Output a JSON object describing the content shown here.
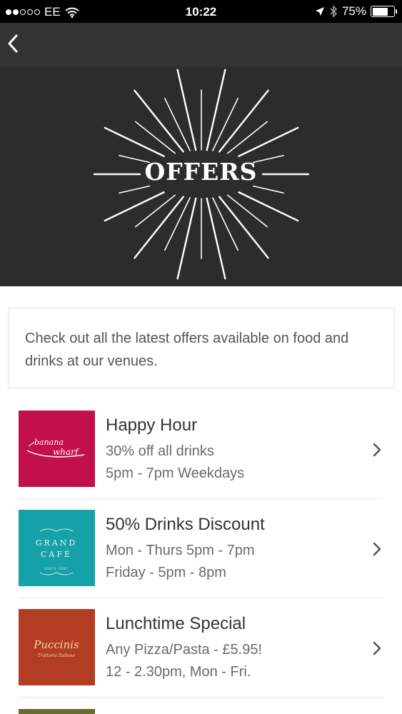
{
  "status_bar": {
    "carrier": "EE",
    "time": "10:22",
    "battery": "75%",
    "battery_level": 0.75,
    "signal_bars_filled": 2,
    "signal_bars_total": 5
  },
  "nav": {
    "back_icon": "chevron-left-icon"
  },
  "hero": {
    "title": "OFFERS"
  },
  "intro": {
    "text": "Check out all the latest offers available on food and drinks at our venues."
  },
  "offers": [
    {
      "title": "Happy Hour",
      "line1": "30% off all drinks",
      "line2": "5pm - 7pm Weekdays",
      "logo_text_1": "banana",
      "logo_text_2": "wharf",
      "logo_color": "#c2104b"
    },
    {
      "title": "50% Drinks Discount",
      "line1": "Mon - Thurs 5pm - 7pm",
      "line2": "Friday - 5pm - 8pm",
      "logo_text_1": "GRAND",
      "logo_text_2": "CAFÉ",
      "logo_text_3": "SINCE 1987",
      "logo_color": "#16a0a8"
    },
    {
      "title": "Lunchtime Special",
      "line1": "Any Pizza/Pasta - £5.95!",
      "line2": "12 - 2.30pm, Mon - Fri.",
      "logo_text_1": "Puccinis",
      "logo_text_2": "Trattoria Italiane",
      "logo_color": "#b33d22"
    }
  ],
  "colors": {
    "nav_bar": "#333334",
    "hero_bg": "#2c2c2d",
    "chevron": "#555555"
  }
}
